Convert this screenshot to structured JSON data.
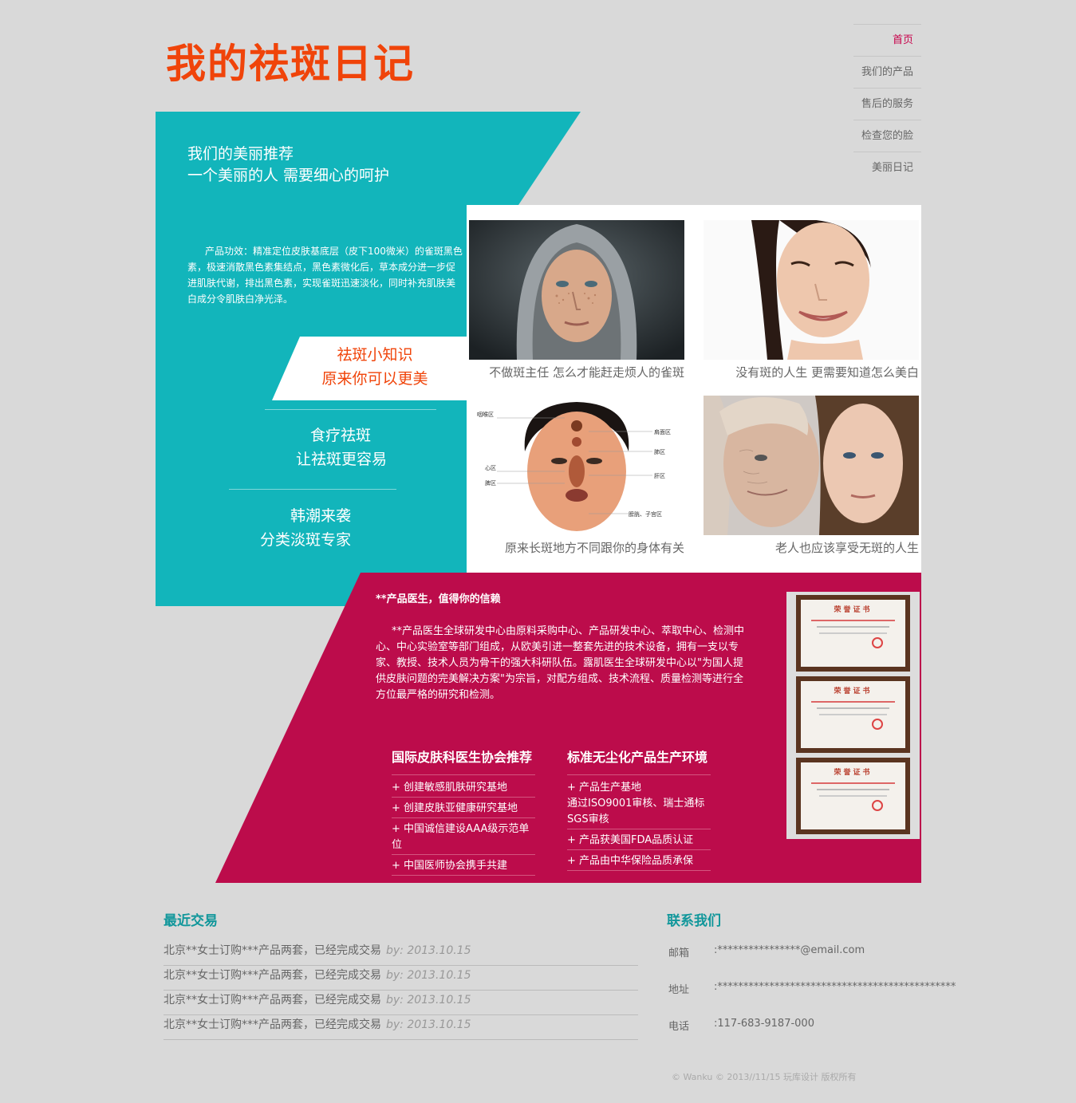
{
  "logo": "我的祛斑日记",
  "nav": [
    {
      "label": "首页",
      "active": true
    },
    {
      "label": "我们的产品"
    },
    {
      "label": "售后的服务"
    },
    {
      "label": "检查您的脸"
    },
    {
      "label": "美丽日记"
    }
  ],
  "hero": {
    "title": "我们的美丽推荐\n一个美丽的人 需要细心的呵护",
    "description": "产品功效：精准定位皮肤基底层（皮下100微米）的雀斑黑色素，极速消散黑色素集结点，黑色素微化后，草本成分进一步促进肌肤代谢，排出黑色素，实现雀斑迅速淡化，同时补充肌肤美白成分令肌肤白净光泽。"
  },
  "menu": {
    "tip": {
      "line1": "祛斑小知识",
      "line2": "原来你可以更美"
    },
    "diet": {
      "line1": "食疗祛斑",
      "line2": "让祛斑更容易"
    },
    "korea": {
      "line1": "韩潮来袭",
      "line2": "分类淡斑专家"
    }
  },
  "gallery": [
    {
      "caption": "不做斑主任 怎么才能赶走烦人的雀斑",
      "image": "freckled-woman-hood"
    },
    {
      "caption": "没有斑的人生 更需要知道怎么美白",
      "image": "smiling-woman"
    },
    {
      "caption": "原来长斑地方不同跟你的身体有关",
      "image": "face-map-diagram"
    },
    {
      "caption": "老人也应该享受无斑的人生",
      "image": "old-and-young-women"
    }
  ],
  "face_map_labels": [
    "咽喉区",
    "心区",
    "脾区",
    "肩面区",
    "肺区",
    "肝区",
    "膀胱、子宫区"
  ],
  "about": {
    "title": "**产品医生，值得你的信赖",
    "description": "**产品医生全球研发中心由原料采购中心、产品研发中心、萃取中心、检测中心、中心实验室等部门组成，从欧美引进一整套先进的技术设备，拥有一支以专家、教授、技术人员为骨干的强大科研队伍。露肌医生全球研发中心以\"为国人提供皮肤问题的完美解决方案\"为宗旨，对配方组成、技术流程、质量检测等进行全方位最严格的研究和检测。",
    "col1": {
      "title": "国际皮肤科医生协会推荐",
      "items": [
        "+ 创建敏感肌肤研究基地",
        "+ 创建皮肤亚健康研究基地",
        "+ 中国诚信建设AAA级示范单位",
        "+ 中国医师协会携手共建"
      ]
    },
    "col2": {
      "title": "标准无尘化产品生产环境",
      "items": [
        "+ 产品生产基地\n通过ISO9001审核、瑞士通标SGS审核",
        "+ 产品获美国FDA品质认证",
        "+ 产品由中华保险品质承保"
      ]
    },
    "cert_title": "荣誉证书"
  },
  "recent": {
    "title": "最近交易",
    "items": [
      {
        "text": "北京**女士订购***产品两套，已经完成交易",
        "by": "by: 2013.10.15"
      },
      {
        "text": "北京**女士订购***产品两套，已经完成交易",
        "by": "by: 2013.10.15"
      },
      {
        "text": "北京**女士订购***产品两套，已经完成交易",
        "by": "by: 2013.10.15"
      },
      {
        "text": "北京**女士订购***产品两套，已经完成交易",
        "by": "by: 2013.10.15"
      }
    ]
  },
  "contact": {
    "title": "联系我们",
    "email_label": "邮箱",
    "email": ":****************@email.com",
    "address_label": "地址",
    "address": ":**********************************************",
    "phone_label": "电话",
    "phone": ":117-683-9187-000"
  },
  "copyright": "© Wanku © 2013//11/15  玩库设计  版权所有",
  "colors": {
    "teal": "#12b5bb",
    "crimson": "#bc0c4b",
    "logo": "#f0440a",
    "nav_active": "#c8004a"
  }
}
